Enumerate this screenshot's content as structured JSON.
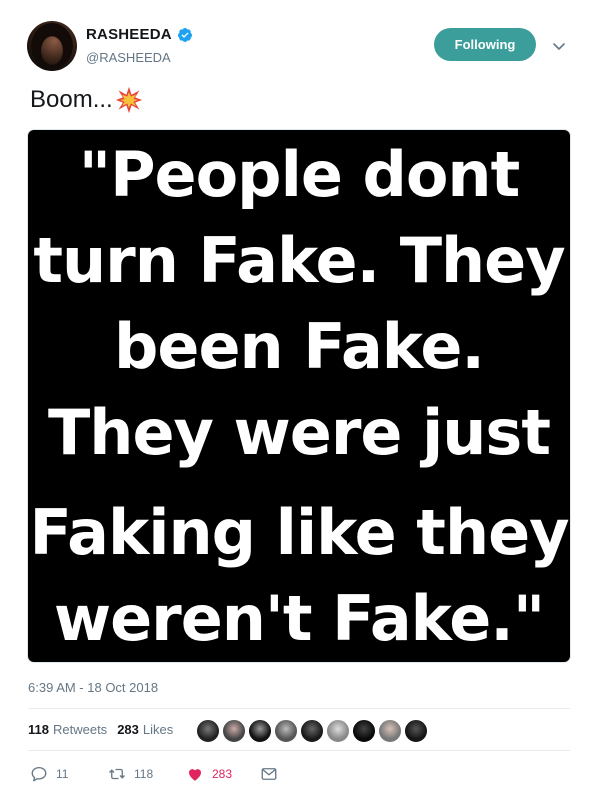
{
  "author": {
    "display_name": "RASHEEDA",
    "handle": "@RASHEEDA",
    "verified": true
  },
  "follow_button": {
    "label": "Following",
    "color": "#3b9e9b"
  },
  "tweet": {
    "text": "Boom...",
    "emoji_icon": "collision-emoji-icon",
    "image_text_lines": [
      "\"People dont",
      "turn Fake. They",
      "been Fake.",
      "They were just",
      "Faking like they",
      "weren't Fake.\""
    ],
    "timestamp": "6:39 AM - 18 Oct 2018"
  },
  "stats": {
    "retweets_count": "118",
    "retweets_label": "Retweets",
    "likes_count": "283",
    "likes_label": "Likes"
  },
  "actions": {
    "reply_count": "11",
    "retweet_count": "118",
    "like_count": "283"
  },
  "colors": {
    "like": "#e0245e",
    "muted": "#657786",
    "verified": "#1da1f2"
  },
  "likers": [
    {
      "name": "liker-avatar-1"
    },
    {
      "name": "liker-avatar-2"
    },
    {
      "name": "liker-avatar-3"
    },
    {
      "name": "liker-avatar-4"
    },
    {
      "name": "liker-avatar-5"
    },
    {
      "name": "liker-avatar-6"
    },
    {
      "name": "liker-avatar-7"
    },
    {
      "name": "liker-avatar-8"
    },
    {
      "name": "liker-avatar-9"
    },
    {
      "name": "liker-avatar-10"
    }
  ]
}
